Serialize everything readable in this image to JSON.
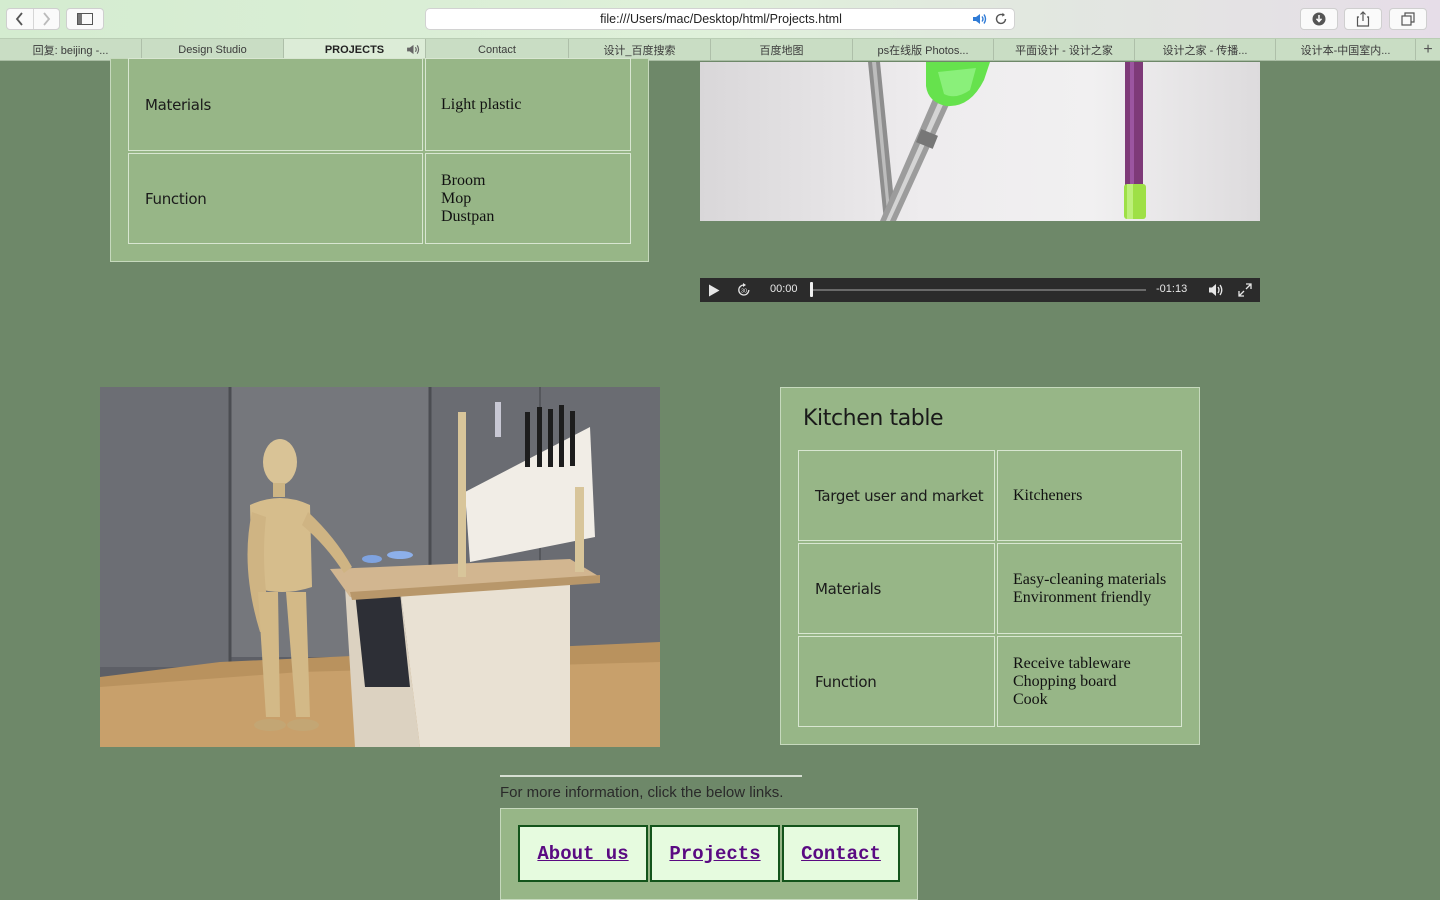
{
  "browser": {
    "address": "file:///Users/mac/Desktop/html/Projects.html",
    "tabs": [
      {
        "label": "回复:  beijing -..."
      },
      {
        "label": "Design Studio"
      },
      {
        "label": "PROJECTS"
      },
      {
        "label": "Contact"
      },
      {
        "label": "设计_百度搜索"
      },
      {
        "label": "百度地图"
      },
      {
        "label": "ps在线版 Photos..."
      },
      {
        "label": "平面设计 - 设计之家"
      },
      {
        "label": "设计之家 - 传播..."
      },
      {
        "label": "设计本-中国室内..."
      }
    ],
    "active_tab_index": 2
  },
  "top_table": {
    "rows": [
      {
        "label": "Materials",
        "values": [
          "Light plastic"
        ]
      },
      {
        "label": "Function",
        "values": [
          "Broom",
          "Mop",
          "Dustpan"
        ]
      }
    ]
  },
  "video": {
    "current_time": "00:00",
    "remaining_time": "-01:13",
    "progress": 0
  },
  "kitchen": {
    "title": "Kitchen table",
    "rows": [
      {
        "label": "Target user and market",
        "values": [
          "Kitcheners"
        ]
      },
      {
        "label": "Materials",
        "values": [
          "Easy-cleaning materials",
          "Environment friendly"
        ]
      },
      {
        "label": "Function",
        "values": [
          "Receive tableware",
          "Chopping board",
          "Cook"
        ]
      }
    ]
  },
  "footer": {
    "text": "For more information, click the below links.",
    "links": [
      {
        "label": "About us"
      },
      {
        "label": "Projects"
      },
      {
        "label": "Contact"
      }
    ]
  }
}
